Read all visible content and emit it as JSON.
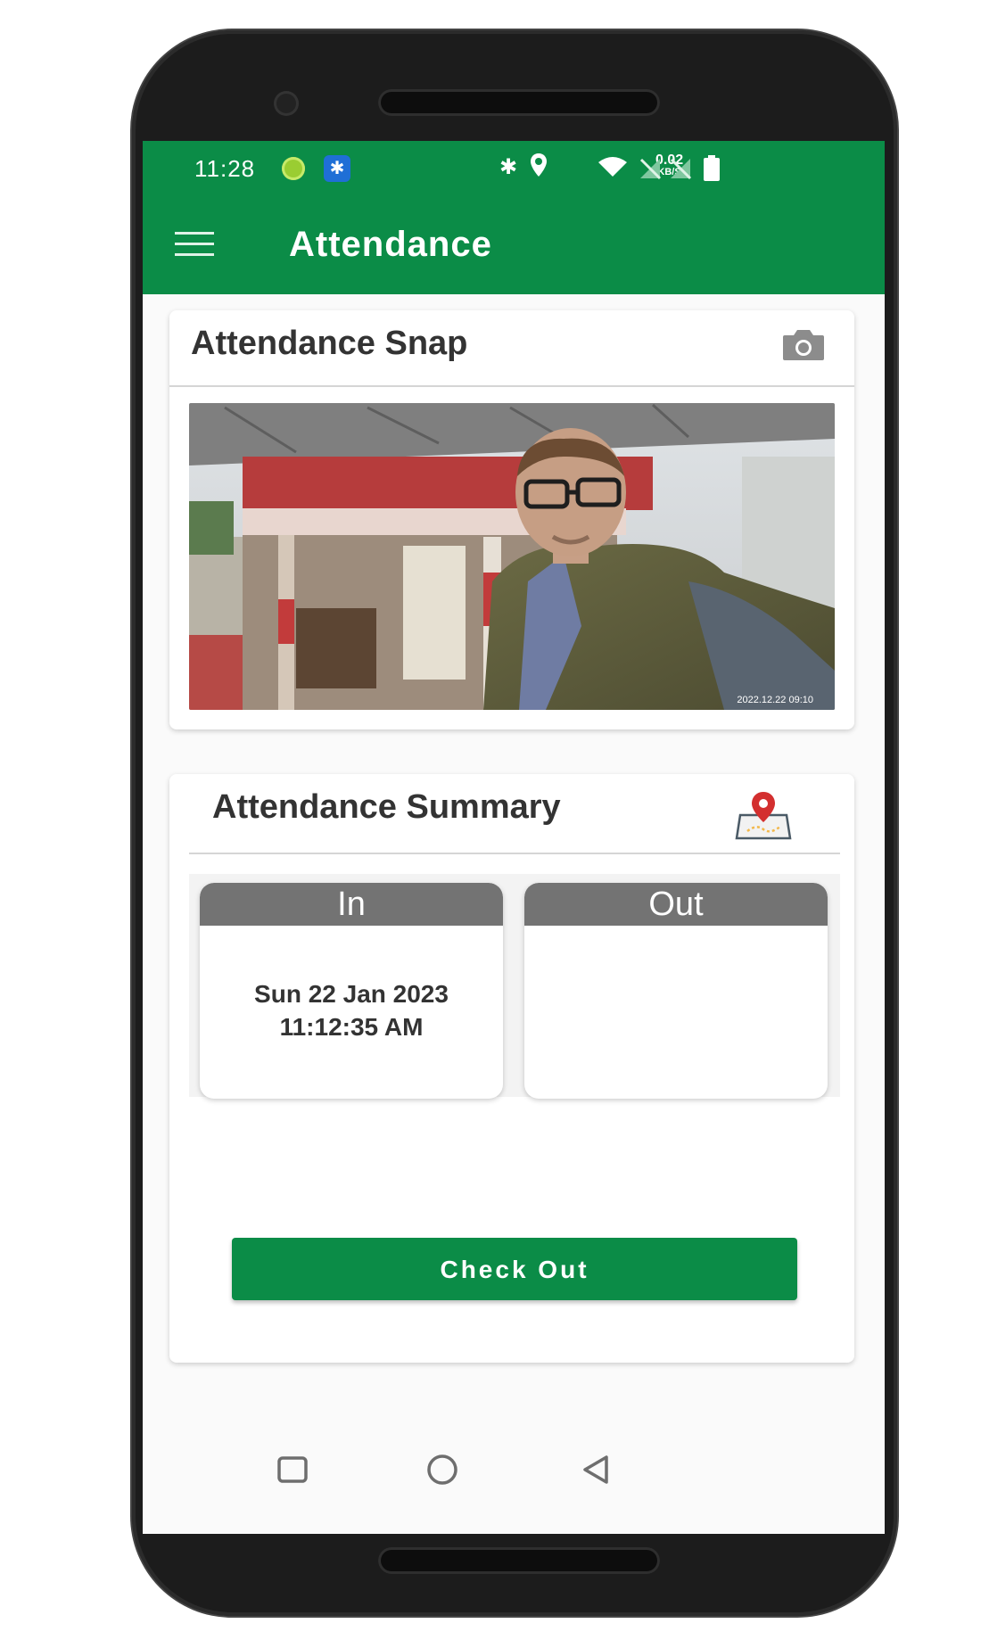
{
  "status_bar": {
    "time": "11:28",
    "net_speed_value": "0.02",
    "net_speed_unit": "KB/S",
    "icons": [
      "green-dot-icon",
      "bluetooth-badge-icon",
      "bluetooth-icon",
      "location-icon",
      "wifi-icon",
      "no-sim-icon",
      "no-sim-icon",
      "battery-icon"
    ]
  },
  "app_bar": {
    "title": "Attendance",
    "menu_icon": "hamburger-menu-icon"
  },
  "snap_card": {
    "title": "Attendance Snap",
    "icon": "camera-icon",
    "photo_timestamp": "2022.12.22 09:10"
  },
  "summary_card": {
    "title": "Attendance Summary",
    "icon": "map-pin-icon",
    "in_label": "In",
    "in_date": "Sun 22 Jan 2023",
    "in_time": "11:12:35 AM",
    "out_label": "Out",
    "out_value": ""
  },
  "checkout_button": {
    "label": "Check Out"
  },
  "nav_bar": {
    "icons": [
      "recents-square-icon",
      "home-circle-icon",
      "back-triangle-icon"
    ]
  },
  "colors": {
    "primary": "#0b8c47",
    "header_gray": "#737373",
    "text_dark": "#333333"
  }
}
